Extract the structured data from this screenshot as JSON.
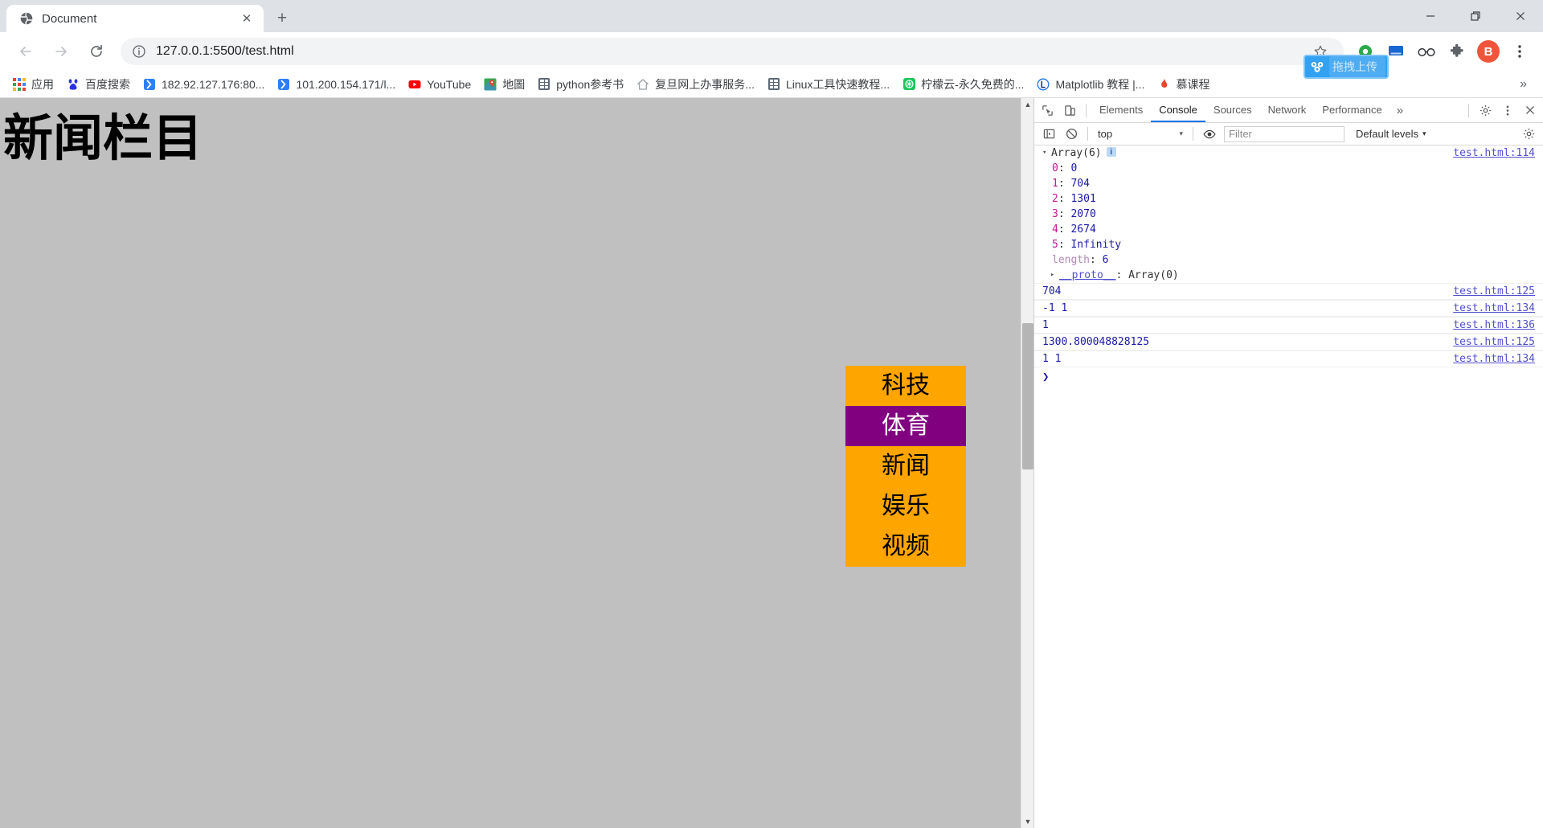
{
  "browser": {
    "tab": {
      "title": "Document",
      "favicon": "globe-icon",
      "close": "✕"
    },
    "newtab_label": "+",
    "window_controls": {
      "minimize": "—",
      "restore": "❐",
      "close": "✕"
    },
    "nav": {
      "back": "←",
      "forward": "→",
      "reload": "⟳"
    },
    "omnibox": {
      "info_icon": "info-circle-icon",
      "url_host": "127.0.0.1:5500",
      "url_path": "/test.html",
      "full_url": "127.0.0.1:5500/test.html",
      "star_icon": "bookmark-star-icon"
    },
    "extension_badge": {
      "label": "拖拽上传",
      "icon": "baidu-netdisk-icon",
      "color": "#32a1f1"
    },
    "toolbar_icons": [
      "chrome-green-icon",
      "screen-share-icon",
      "glasses-icon",
      "extensions-puzzle-icon"
    ],
    "profile_avatar": {
      "letter": "B",
      "color": "#f0553c"
    },
    "menu_icon": "kebab-menu-icon"
  },
  "bookmarks": {
    "overflow": "»",
    "items": [
      {
        "label": "应用",
        "icon": "apps-grid-icon",
        "color": "#ea4335"
      },
      {
        "label": "百度搜索",
        "icon": "baidu-icon",
        "color": "#2932e1"
      },
      {
        "label": "182.92.127.176:80...",
        "icon": "blue-bracket-icon",
        "color": "#1a73e8"
      },
      {
        "label": "101.200.154.171/l...",
        "icon": "blue-bracket-icon",
        "color": "#1a73e8"
      },
      {
        "label": "YouTube",
        "icon": "youtube-icon",
        "color": "#ff0000"
      },
      {
        "label": "地圖",
        "icon": "maps-pin-icon",
        "color": "#34a853"
      },
      {
        "label": "python参考书",
        "icon": "building-icon",
        "color": "#5f6974"
      },
      {
        "label": "复旦网上办事服务...",
        "icon": "house-icon",
        "color": "#9aa0a6"
      },
      {
        "label": "Linux工具快速教程...",
        "icon": "building-icon",
        "color": "#5f6974"
      },
      {
        "label": "柠檬云-永久免费的...",
        "icon": "lemon-icon",
        "color": "#1ec55a"
      },
      {
        "label": "Matplotlib 教程 |...",
        "icon": "circle-l-icon",
        "color": "#1a73e8"
      },
      {
        "label": "慕课程",
        "icon": "flame-icon",
        "color": "#e8452c"
      }
    ]
  },
  "page": {
    "heading": "新闻栏目",
    "background_color": "#c0c0c0",
    "menu_widget": {
      "background_color": "#ffa500",
      "active_color": "#800080",
      "items": [
        {
          "label": "科技",
          "active": false
        },
        {
          "label": "体育",
          "active": true
        },
        {
          "label": "新闻",
          "active": false
        },
        {
          "label": "娱乐",
          "active": false
        },
        {
          "label": "视频",
          "active": false
        }
      ]
    },
    "scrollbar": {
      "up": "▲",
      "down": "▼"
    }
  },
  "devtools": {
    "inspect_icon": "inspect-cursor-icon",
    "device_icon": "device-toolbar-icon",
    "tabs": [
      {
        "label": "Elements",
        "active": false
      },
      {
        "label": "Console",
        "active": true
      },
      {
        "label": "Sources",
        "active": false
      },
      {
        "label": "Network",
        "active": false
      },
      {
        "label": "Performance",
        "active": false
      }
    ],
    "more_tabs": "»",
    "settings_icon": "gear-icon",
    "kebab_icon": "kebab-menu-icon",
    "close_icon": "close-icon",
    "console_toolbar": {
      "sidebar_icon": "console-sidebar-icon",
      "clear_icon": "clear-console-icon",
      "context": "top",
      "context_caret": "▾",
      "eye_icon": "live-expression-eye-icon",
      "filter_placeholder": "Filter",
      "filter_value": "",
      "levels_label": "Default levels",
      "levels_caret": "▾",
      "settings_icon": "gear-icon"
    },
    "console_log": [
      {
        "type": "object",
        "triangle": "▾",
        "label": "Array(6)",
        "info_badge": "i",
        "source": "test.html:114",
        "properties": [
          {
            "key": "0",
            "value": "0"
          },
          {
            "key": "1",
            "value": "704"
          },
          {
            "key": "2",
            "value": "1301"
          },
          {
            "key": "3",
            "value": "2070"
          },
          {
            "key": "4",
            "value": "2674"
          },
          {
            "key": "5",
            "value": "Infinity"
          }
        ],
        "length_key": "length",
        "length_value": "6",
        "proto_triangle": "▸",
        "proto_key": "__proto__",
        "proto_value": "Array(0)"
      },
      {
        "type": "value",
        "text": "704",
        "source": "test.html:125"
      },
      {
        "type": "value",
        "text": "-1 1",
        "source": "test.html:134"
      },
      {
        "type": "value",
        "text": "1",
        "source": "test.html:136"
      },
      {
        "type": "value",
        "text": "1300.800048828125",
        "source": "test.html:125"
      },
      {
        "type": "value",
        "text": "1 1",
        "source": "test.html:134"
      }
    ],
    "prompt": "❯"
  }
}
